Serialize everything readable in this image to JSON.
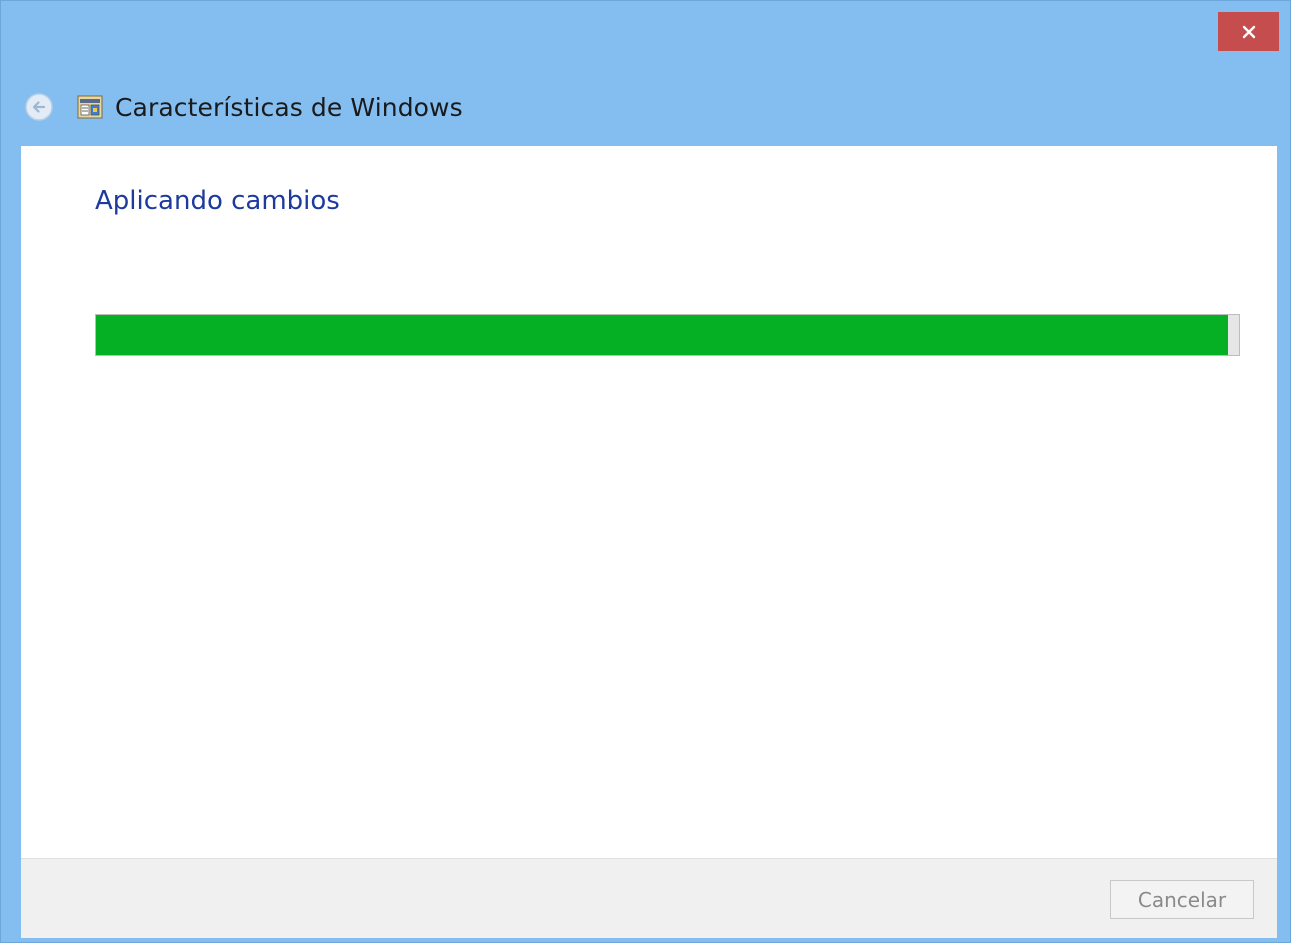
{
  "window": {
    "title": "Características de Windows",
    "title_bar_color": "#84bdf0",
    "close_button_color": "#c64d4d"
  },
  "icons": {
    "close": "close-icon",
    "back": "back-arrow-icon",
    "app": "windows-features-icon"
  },
  "main": {
    "heading": "Aplicando cambios",
    "heading_color": "#1e3a9e",
    "progress": {
      "percent": 99,
      "fill_color": "#06b025"
    }
  },
  "footer": {
    "cancel_label": "Cancelar",
    "cancel_enabled": false
  }
}
